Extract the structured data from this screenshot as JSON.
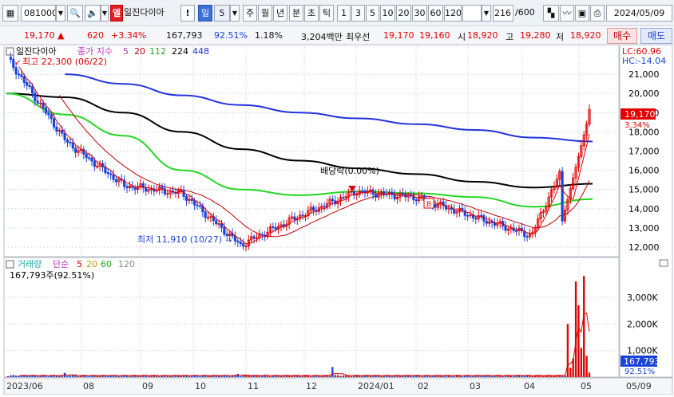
{
  "toolbar": {
    "code": "081000",
    "market_badge": "엘",
    "name": "일진다이아",
    "exclaim": "!",
    "period_day": "일",
    "period_num": "5",
    "periods": [
      "주",
      "월",
      "년",
      "분",
      "초",
      "틱"
    ],
    "intervals": [
      "1",
      "3",
      "5",
      "10",
      "20",
      "30",
      "60",
      "120"
    ],
    "count": "216",
    "count_max": "/600",
    "date": "2024/05/09"
  },
  "quote": {
    "price": "19,170",
    "change": "620",
    "change_pct": "+3.34%",
    "volume": "167,793",
    "volume_ratio": "92.51%",
    "turnover_rate": "1.18%",
    "amount": "3,204백만",
    "best_ask_label": "최우선",
    "best_ask": "19,170",
    "best_bid": "19,160",
    "open_label": "시",
    "open": "18,920",
    "high_label": "고",
    "high": "19,280",
    "low_label": "저",
    "low": "18,920",
    "buy_label": "매수",
    "sell_label": "매도"
  },
  "price_panel": {
    "legend_name": "일진다이아",
    "legend_ma_label": "종가 지수",
    "legend_ma": [
      "5",
      "20",
      "112",
      "224",
      "448"
    ],
    "high_note": "최고 22,300 (06/22)",
    "low_note": "최저 11,910 (10/27)",
    "dividend_note": "배당락(0.00%)",
    "lc": "LC:60.96",
    "hc": "HC:-14.04",
    "last_price": "19,170",
    "last_pct": "3.34%",
    "b_marker": "B"
  },
  "volume_panel": {
    "legend_label": "거래량",
    "legend_type": "단순",
    "legend_ma": [
      "5",
      "20",
      "60",
      "120"
    ],
    "value_note": "167,793주(92.51%)",
    "last_volume": "167,793",
    "last_pct": "92.51%"
  },
  "colors": {
    "up": "#e00000",
    "down": "#1a44d8",
    "ma5": "#e00000",
    "ma20": "#c00000",
    "ma112": "#22d822",
    "ma224": "#000000",
    "ma448": "#2233dd"
  },
  "chart_data": [
    {
      "type": "line",
      "title": "",
      "x": [
        "2023/06",
        "08",
        "09",
        "10",
        "11",
        "12",
        "2024/01",
        "02",
        "03",
        "04",
        "05"
      ],
      "ylim": [
        11500,
        22500
      ],
      "y_ticks": [
        "21,000",
        "20,000",
        "19,000",
        "18,000",
        "17,000",
        "16,000",
        "15,000",
        "14,000",
        "13,000",
        "12,000"
      ],
      "series": [
        {
          "name": "종가",
          "values": [
            21800,
            17500,
            15200,
            14800,
            12100,
            13600,
            14900,
            14600,
            13600,
            12600,
            19170
          ]
        },
        {
          "name": "112",
          "values": [
            20000,
            18900,
            17800,
            16000,
            15000,
            14700,
            14900,
            14800,
            14600,
            14100,
            14500
          ]
        },
        {
          "name": "224",
          "values": [
            20000,
            19800,
            19000,
            18000,
            17100,
            16500,
            16100,
            15800,
            15400,
            15100,
            15300
          ]
        },
        {
          "name": "448",
          "values": [
            null,
            21000,
            20500,
            19900,
            19400,
            19000,
            18700,
            18400,
            18100,
            17700,
            17500
          ]
        }
      ],
      "annotations": [
        "최고 22,300 (06/22)",
        "최저 11,910 (10/27)",
        "배당락(0.00%)"
      ]
    },
    {
      "type": "bar",
      "title": "",
      "x": [
        "2023/06",
        "08",
        "09",
        "10",
        "11",
        "12",
        "2024/01",
        "02",
        "03",
        "04",
        "05"
      ],
      "ylim": [
        0,
        3900000
      ],
      "y_ticks": [
        "3,000K",
        "2,000K",
        "1,000K"
      ],
      "values": [
        120000,
        60000,
        60000,
        380000,
        50000,
        40000,
        120000,
        40000,
        40000,
        40000,
        3800000
      ],
      "annotations": [
        "167,793주(92.51%)"
      ]
    }
  ],
  "axis": {
    "x_labels": [
      "2023/06",
      "08",
      "09",
      "10",
      "11",
      "12",
      "2024/01",
      "02",
      "03",
      "04",
      "05",
      "05/09"
    ]
  }
}
